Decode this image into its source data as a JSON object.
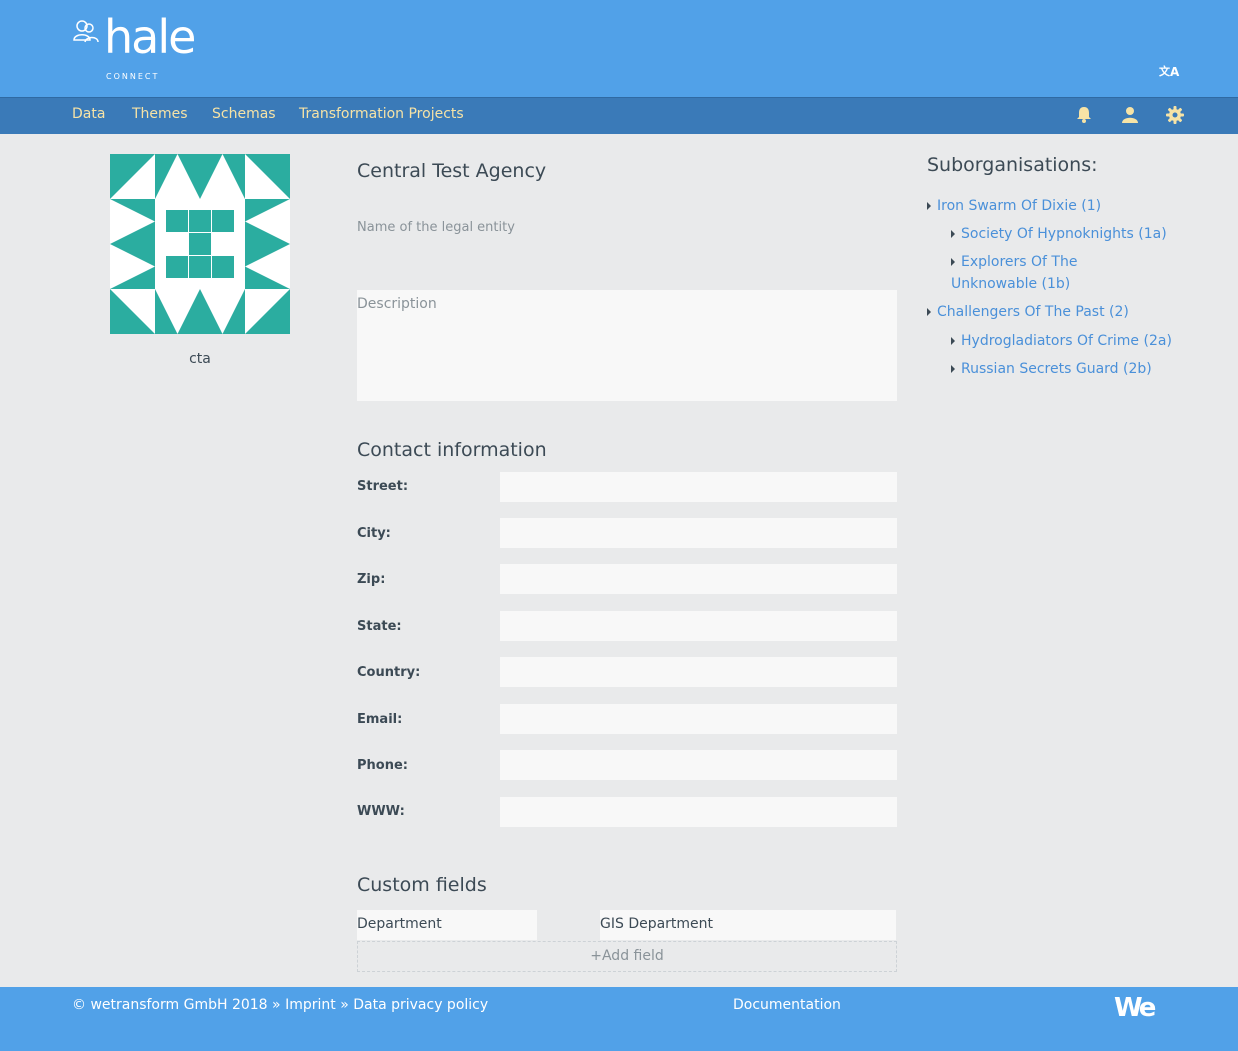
{
  "header": {
    "logo_text": "hale",
    "logo_sub": "CONNECT",
    "translate_icon": "translate-icon"
  },
  "nav": {
    "items": [
      {
        "label": "Data"
      },
      {
        "label": "Themes"
      },
      {
        "label": "Schemas"
      },
      {
        "label": "Transformation Projects"
      }
    ],
    "icons": [
      "bell-icon",
      "user-icon",
      "gear-icon"
    ],
    "accent": "#f6e3a6"
  },
  "profile": {
    "short_name": "cta",
    "title": "Central Test Agency",
    "legal_placeholder": "Name of the legal entity",
    "description_placeholder": "Description",
    "avatar_color": "#2bada0"
  },
  "contact": {
    "title": "Contact information",
    "fields": [
      {
        "label": "Street:",
        "value": ""
      },
      {
        "label": "City:",
        "value": ""
      },
      {
        "label": "Zip:",
        "value": ""
      },
      {
        "label": "State:",
        "value": ""
      },
      {
        "label": "Country:",
        "value": ""
      },
      {
        "label": "Email:",
        "value": ""
      },
      {
        "label": "Phone:",
        "value": ""
      },
      {
        "label": "WWW:",
        "value": ""
      }
    ]
  },
  "custom_fields": {
    "title": "Custom fields",
    "items": [
      {
        "key": "Department",
        "value": "GIS Department"
      }
    ],
    "add_label": "+Add field"
  },
  "suborganisations": {
    "title": "Suborganisations:",
    "items": [
      {
        "label": "Iron Swarm Of Dixie (1)",
        "level": 0
      },
      {
        "label": "Society Of Hypnoknights (1a)",
        "level": 1
      },
      {
        "label": "Explorers Of The Unknowable (1b)",
        "level": 1
      },
      {
        "label": "Challengers Of The Past (2)",
        "level": 0
      },
      {
        "label": "Hydrogladiators Of Crime (2a)",
        "level": 1
      },
      {
        "label": "Russian Secrets Guard (2b)",
        "level": 1
      }
    ]
  },
  "footer": {
    "copyright": "© wetransform GmbH 2018",
    "imprint": "Imprint",
    "privacy": "Data privacy policy",
    "separator": "»",
    "documentation": "Documentation",
    "brand_logo": "We"
  },
  "colors": {
    "header": "#51a1e8",
    "navbar": "#3a7ab8",
    "link": "#4a90d9"
  }
}
